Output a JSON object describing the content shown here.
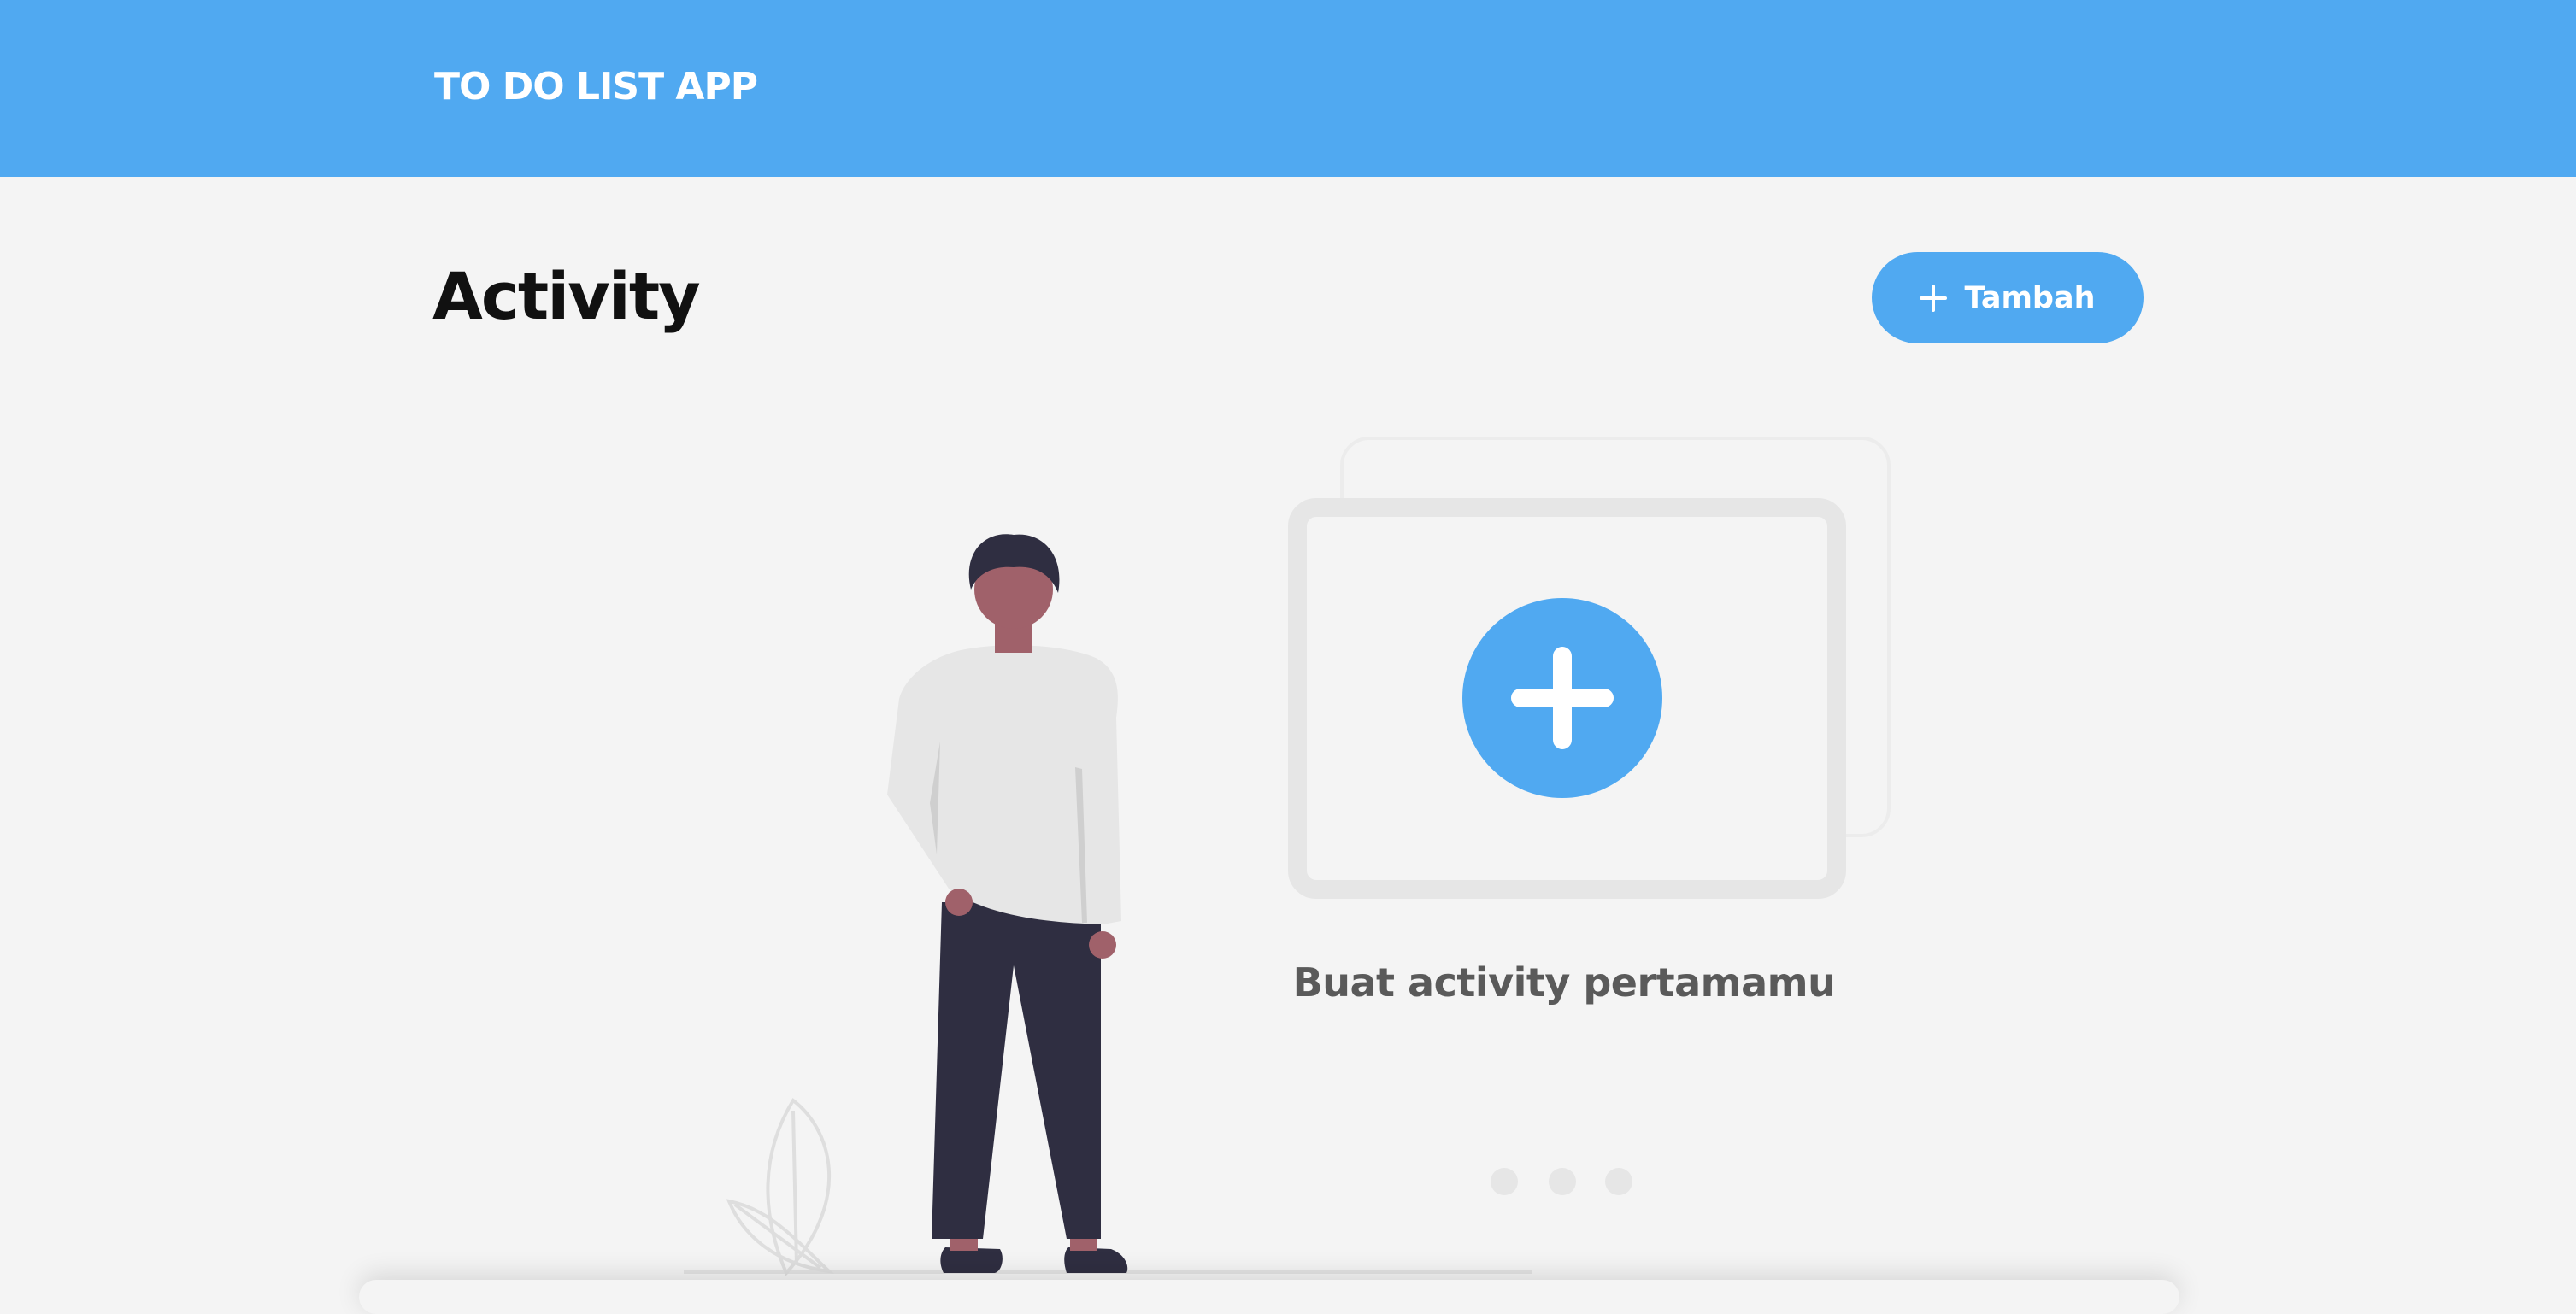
{
  "app": {
    "title": "TO DO LIST APP"
  },
  "page": {
    "title": "Activity"
  },
  "toolbar": {
    "add_label": "Tambah",
    "add_icon": "plus-icon"
  },
  "empty_state": {
    "message": "Buat activity pertamamu",
    "icon": "plus-circle-icon",
    "carousel_dots": 3
  },
  "colors": {
    "header": "#50a9f1",
    "accent": "#50a9f1",
    "background": "#f4f4f4",
    "title_text": "#111111",
    "empty_text": "#5a5a5a"
  }
}
